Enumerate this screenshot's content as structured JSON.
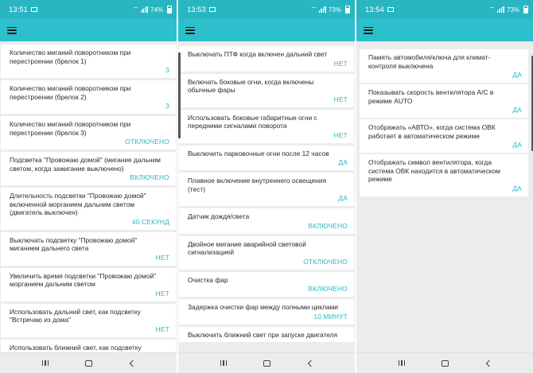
{
  "screens": [
    {
      "status": {
        "time": "13:51",
        "battery": "74%"
      },
      "items": [
        {
          "title": "Количество миганий поворотником при перестроении (брелок 1)",
          "value": "3"
        },
        {
          "title": "Количество миганий поворотником при перестроении (брелок 2)",
          "value": "3"
        },
        {
          "title": "Количество миганий поворотником при перестроении (брелок 3)",
          "value": "ОТКЛЮЧЕНО"
        },
        {
          "title": "Подсветка \"Провожаю домой\" (мигание дальним светом, когда зажигание выключено)",
          "value": "ВКЛЮЧЕНО"
        },
        {
          "title": "Длительность подсветки \"Провожаю домой\" включенной морганием дальним светом (двигатель выключен)",
          "value": "40 СЕКУНД"
        },
        {
          "title": "Выключать подсветку \"Провожаю домой\" миганием дальнего света",
          "value": "НЕТ"
        },
        {
          "title": "Увеличить время подсветки \"Провожаю домой\" морганием дальним светом",
          "value": "НЕТ"
        },
        {
          "title": "Использовать дальний свет, как подсветку \"Встречаю из дома\"",
          "value": "НЕТ"
        },
        {
          "title": "Использовать ближний свет, как подсветку \"Встречаю из дома\"",
          "value": ""
        }
      ]
    },
    {
      "status": {
        "time": "13:53",
        "battery": "73%"
      },
      "items": [
        {
          "title": "Выключать ПТФ когда включен дальний свет",
          "value": "НЕТ"
        },
        {
          "title": "Включать боковые огни, когда включены обычные фары",
          "value": "НЕТ"
        },
        {
          "title": "Использовать боковые габаритные огни с передними сигналами поворота",
          "value": "НЕТ"
        },
        {
          "title": "Выключить парковочные огни после 12 часов",
          "value": "ДА"
        },
        {
          "title": "Плавное включение внутреннего освещения (тест)",
          "value": "ДА"
        },
        {
          "title": "Датчик дождя/света",
          "value": "ВКЛЮЧЕНО"
        },
        {
          "title": "Двойное мигание аварийной световой сигнализацией",
          "value": "ОТКЛЮЧЕНО"
        },
        {
          "title": "Очистка фар",
          "value": "ВКЛЮЧЕНО"
        },
        {
          "title": "Задержка очистки фар между полными циклами",
          "value": "10 МИНУТ"
        },
        {
          "title": "Выключить ближний свет при запуске двигателя",
          "value": ""
        }
      ]
    },
    {
      "status": {
        "time": "13:54",
        "battery": "73%"
      },
      "items": [
        {
          "title": "Память автомобиля/ключа для климат-контроля выключена",
          "value": "ДА"
        },
        {
          "title": "Показывать скорость вентилятора A/C в режиме AUTO",
          "value": "ДА"
        },
        {
          "title": "Отображать «АВТО», когда система ОВК работает в автоматическом режиме",
          "value": "ДА"
        },
        {
          "title": "Отображать символ вентилятора, когда система ОВК находится в автоматическом режиме",
          "value": "ДА"
        }
      ]
    }
  ],
  "colors": {
    "accent": "#29b6c2",
    "appbar": "#2cc0cc",
    "background": "#ececec"
  },
  "icons": {
    "menu": "hamburger-icon",
    "recent": "recent-apps-icon",
    "home": "home-icon",
    "back": "back-icon"
  }
}
